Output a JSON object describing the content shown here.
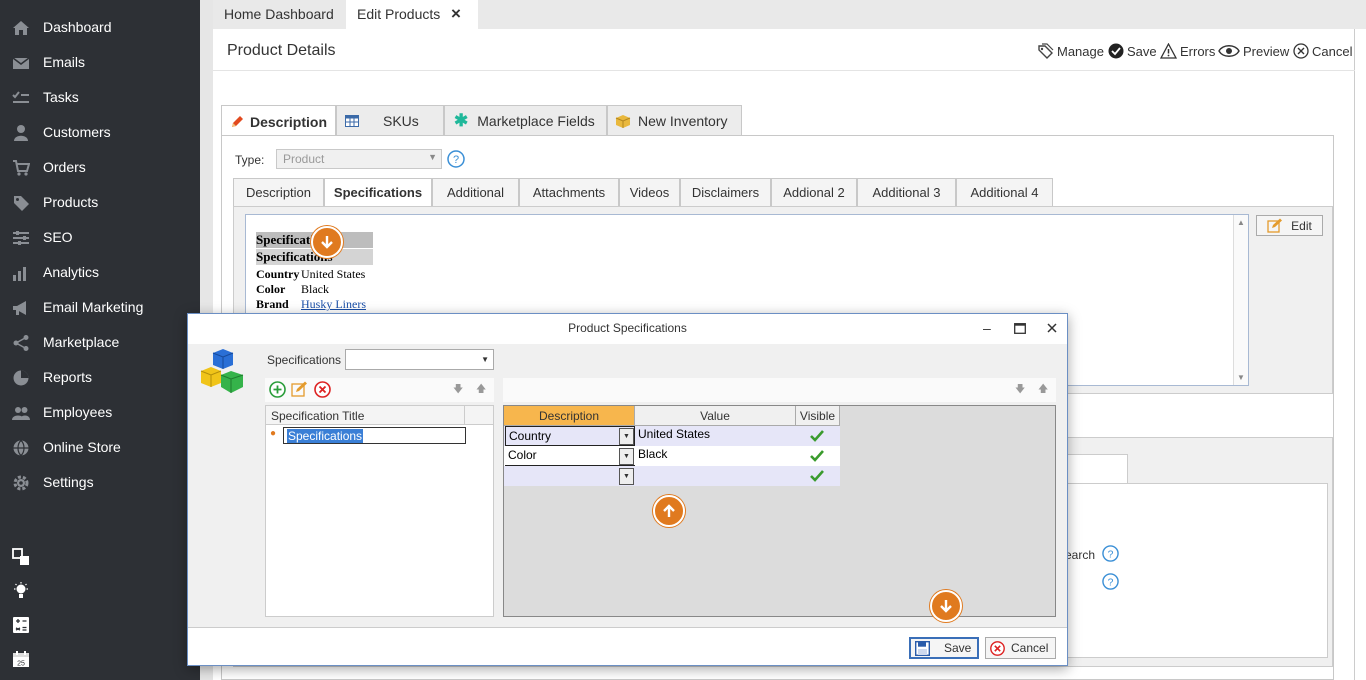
{
  "sidebar": {
    "items": [
      {
        "label": "Dashboard",
        "icon": "home-icon"
      },
      {
        "label": "Emails",
        "icon": "envelope-icon"
      },
      {
        "label": "Tasks",
        "icon": "tasks-icon"
      },
      {
        "label": "Customers",
        "icon": "user-icon"
      },
      {
        "label": "Orders",
        "icon": "cart-icon"
      },
      {
        "label": "Products",
        "icon": "tag-icon"
      },
      {
        "label": "SEO",
        "icon": "sliders-icon"
      },
      {
        "label": "Analytics",
        "icon": "bar-chart-icon"
      },
      {
        "label": "Email Marketing",
        "icon": "megaphone-icon"
      },
      {
        "label": "Marketplace",
        "icon": "share-icon"
      },
      {
        "label": "Reports",
        "icon": "pie-chart-icon"
      },
      {
        "label": "Employees",
        "icon": "users-icon"
      },
      {
        "label": "Online Store",
        "icon": "globe-icon"
      },
      {
        "label": "Settings",
        "icon": "gear-icon"
      }
    ]
  },
  "top_tabs": {
    "home": "Home Dashboard",
    "edit": "Edit Products",
    "close": "×"
  },
  "page": {
    "title": "Product Details",
    "toolbar": {
      "manage": "Manage",
      "save": "Save",
      "errors": "Errors",
      "preview": "Preview",
      "cancel": "Cancel"
    }
  },
  "outer_tabs": [
    "Description",
    "SKUs",
    "Marketplace Fields",
    "New Inventory"
  ],
  "type_field": {
    "label": "Type:",
    "value": "Product"
  },
  "inner_tabs": [
    "Description",
    "Specifications",
    "Additional",
    "Attachments",
    "Videos",
    "Disclaimers",
    "Addional 2",
    "Additional 3",
    "Additional 4"
  ],
  "editor": {
    "heading1": "Specifications",
    "heading2": "Specifications",
    "rows": [
      {
        "key": "Country",
        "value": "United States"
      },
      {
        "key": "Color",
        "value": "Black"
      },
      {
        "key": "Brand",
        "value": "Husky Liners"
      }
    ],
    "edit_button": "Edit"
  },
  "background_fragment": "earch",
  "dialog": {
    "title": "Product Specifications",
    "spec_label": "Specifications",
    "spec_select": "",
    "left_col_header": "Specification Title",
    "left_rows": [
      "Specifications"
    ],
    "grid_headers": [
      "Description",
      "Value",
      "Visible"
    ],
    "grid_rows": [
      {
        "description": "Country",
        "value": "United States",
        "visible": true
      },
      {
        "description": "Color",
        "value": "Black",
        "visible": true
      },
      {
        "description": "",
        "value": "",
        "visible": true
      }
    ],
    "save": "Save",
    "cancel": "Cancel"
  },
  "colors": {
    "sidebar": "#2d3035",
    "accent_orange": "#e07a1f",
    "dialog_border": "#6b8fc4",
    "grid_header_orange": "#f7b64d"
  }
}
